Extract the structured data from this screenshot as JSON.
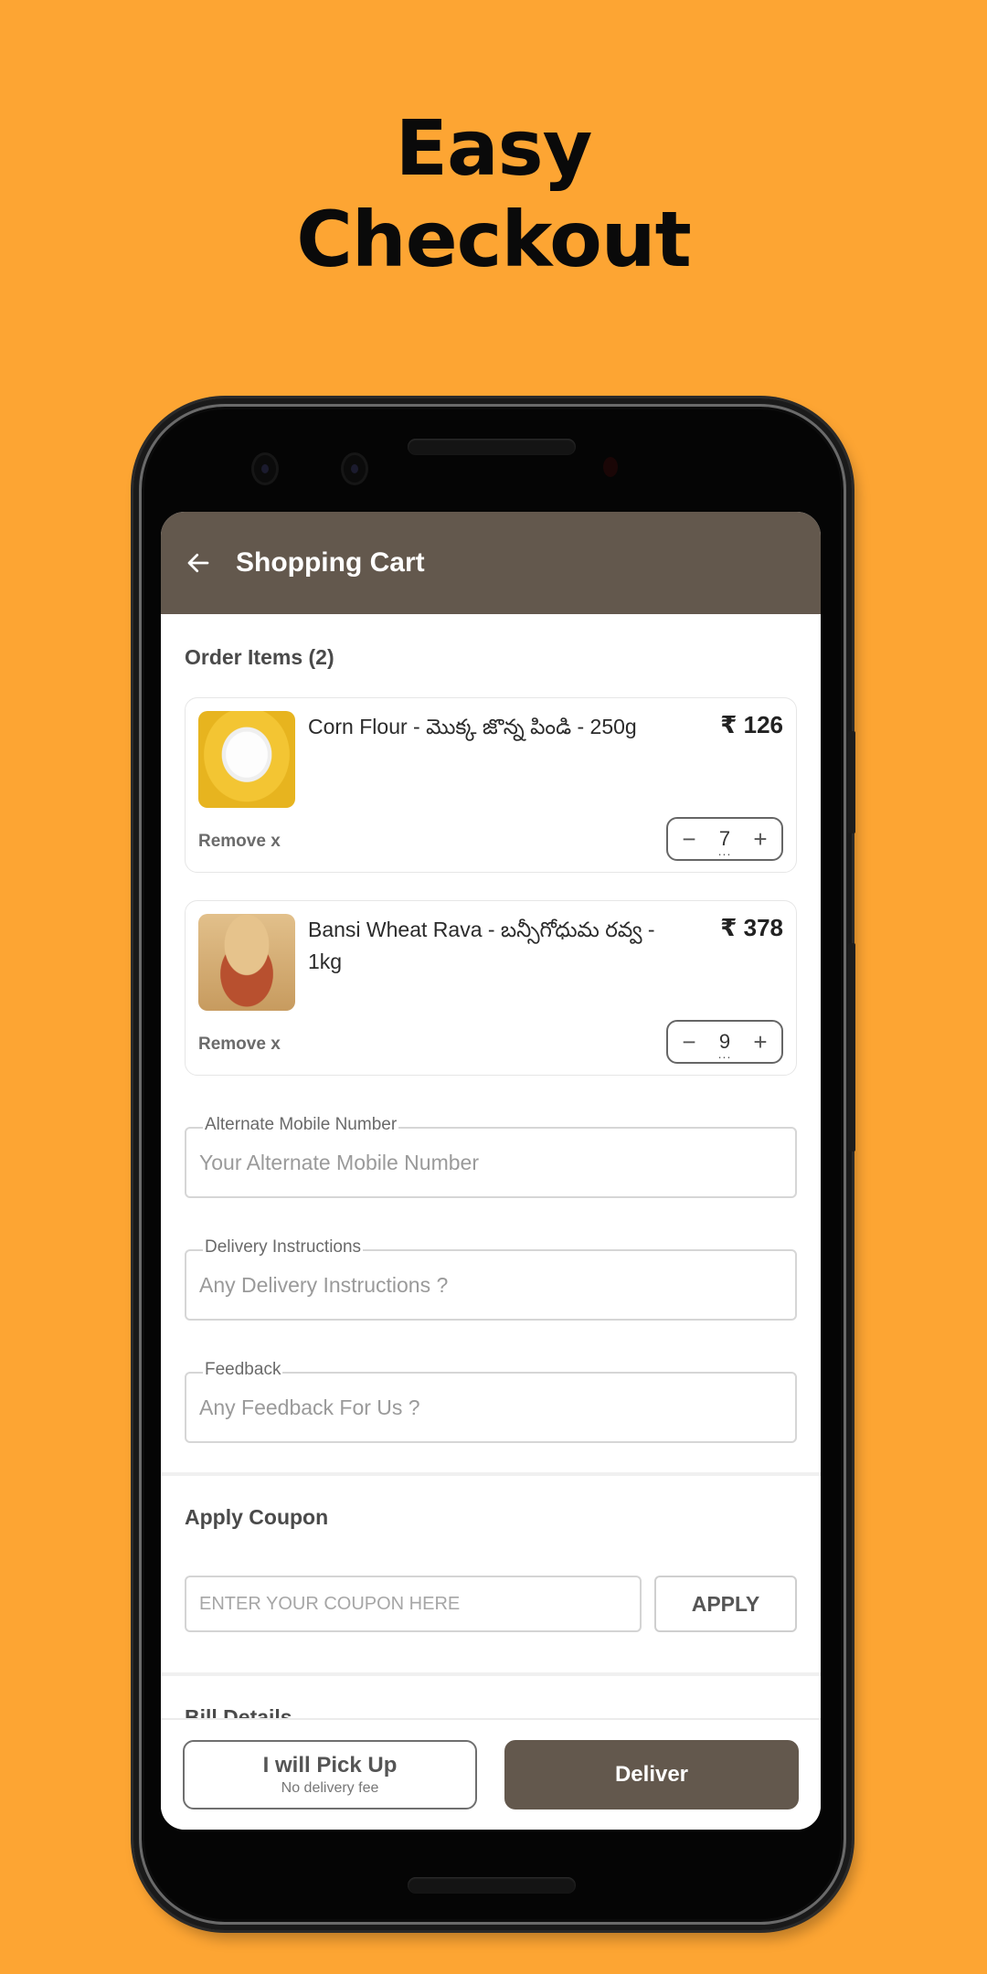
{
  "promo": {
    "headline_line1": "Easy",
    "headline_line2": "Checkout",
    "background_color": "#FDA533"
  },
  "appbar": {
    "back_icon": "arrow-left-icon",
    "title": "Shopping Cart",
    "color": "#63584D"
  },
  "order": {
    "title": "Order Items (2)",
    "items": [
      {
        "name": "Corn Flour - మొక్క జొన్న పిండి - 250g",
        "price": "₹ 126",
        "image": "corn-flour-bowl",
        "remove_label": "Remove x",
        "quantity": "7",
        "minus": "−",
        "plus": "+"
      },
      {
        "name": "Bansi Wheat Rava - బన్సీగోధుమ రవ్వ - 1kg",
        "price": "₹ 378",
        "image": "wheat-rava-pot",
        "remove_label": "Remove x",
        "quantity": "9",
        "minus": "−",
        "plus": "+"
      }
    ]
  },
  "fields": [
    {
      "label": "Alternate Mobile Number",
      "placeholder": "Your Alternate Mobile Number",
      "value": ""
    },
    {
      "label": "Delivery Instructions",
      "placeholder": "Any Delivery Instructions ?",
      "value": ""
    },
    {
      "label": "Feedback",
      "placeholder": "Any Feedback For Us ?",
      "value": ""
    }
  ],
  "coupon": {
    "title": "Apply Coupon",
    "placeholder": "ENTER YOUR COUPON HERE",
    "value": "",
    "apply_label": "APPLY"
  },
  "bill": {
    "title": "Bill Details"
  },
  "bottom_bar": {
    "pickup_label": "I will Pick Up",
    "pickup_sub": "No delivery fee",
    "deliver_label": "Deliver"
  }
}
